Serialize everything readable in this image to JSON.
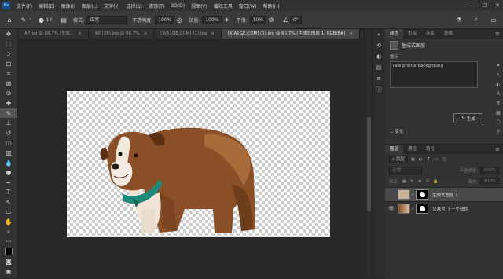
{
  "app": {
    "logo": "Ps"
  },
  "menu": [
    "文件(F)",
    "编辑(E)",
    "图像(I)",
    "图层(L)",
    "文字(Y)",
    "选择(S)",
    "滤镜(T)",
    "3D(D)",
    "视图(V)",
    "增效工具",
    "窗口(W)",
    "帮助(H)"
  ],
  "options": {
    "size": "13",
    "mode_label": "模式:",
    "mode_value": "正常",
    "opacity_label": "不透明度:",
    "opacity_value": "100%",
    "flow_label": "流量:",
    "flow_value": "100%",
    "smooth_label": "平滑:",
    "smooth_value": "10%",
    "angle_value": "0°"
  },
  "tabs": [
    {
      "label": "AP.jpg @ 66.7% (生成...",
      "active": false
    },
    {
      "label": "4K (38).jpg @ 66.7%",
      "active": false
    },
    {
      "label": "[XIA1GE.COM] (1).jpg",
      "active": false
    },
    {
      "label": "[XIA1GE.COM] (5).jpg @ 66.7% (生成式图层 1, RGB/8#)",
      "active": true
    }
  ],
  "properties_panel": {
    "tabs": [
      "颜色",
      "色板",
      "渐变",
      "图案"
    ],
    "section_title": "生成式图层",
    "prompt_label": "提示",
    "prompt_value": "raw prairie background",
    "generate_button": "生成",
    "variations_label": "变化"
  },
  "layers_panel": {
    "tabs": [
      "图层",
      "通道",
      "路径"
    ],
    "kind_label": "类型",
    "blend_mode": "正常",
    "opacity_label": "不透明度:",
    "opacity_value": "100%",
    "lock_label": "锁定:",
    "fill_label": "填充:",
    "fill_value": "100%",
    "layers": [
      {
        "name": "生成式图层 1",
        "selected": true
      },
      {
        "name": "公众号:下十个软件",
        "selected": false
      }
    ]
  },
  "colors": {
    "menubar": "#323232",
    "canvas_bg": "#282828",
    "dog_brown": "#8a4f26",
    "collar": "#1f8a7a"
  }
}
